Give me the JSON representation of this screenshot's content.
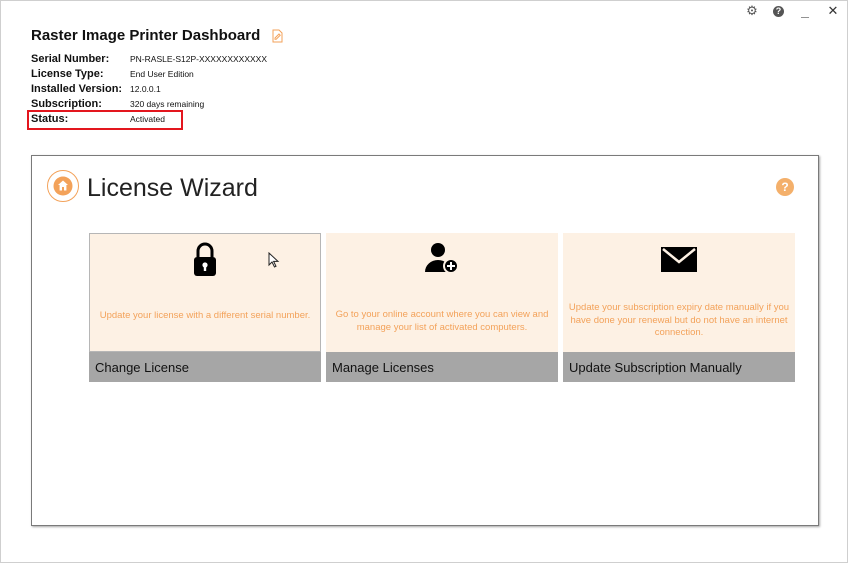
{
  "window": {
    "controls": {
      "settings_icon": "gear-icon",
      "help_icon": "help-icon",
      "help_glyph": "?",
      "minimize_glyph": "_",
      "close_glyph": "✕"
    }
  },
  "header": {
    "title": "Raster Image Printer Dashboard",
    "rows": [
      {
        "label": "Serial Number:",
        "value": "PN-RASLE-S12P-XXXXXXXXXXXX"
      },
      {
        "label": "License Type:",
        "value": "End User Edition"
      },
      {
        "label": "Installed Version:",
        "value": "12.0.0.1"
      },
      {
        "label": "Subscription:",
        "value": "320 days remaining"
      },
      {
        "label": "Status:",
        "value": "Activated"
      }
    ]
  },
  "wizard": {
    "title": "License Wizard",
    "help_glyph": "?",
    "tiles": [
      {
        "icon": "lock-icon",
        "description": "Update your license with a different serial number.",
        "label": "Change License"
      },
      {
        "icon": "add-user-icon",
        "description": "Go to your online account where you can view and manage your list of activated computers.",
        "label": "Manage Licenses"
      },
      {
        "icon": "envelope-icon",
        "description": "Update your subscription expiry date manually if you have done your renewal but do not have an internet connection.",
        "label": "Update Subscription Manually"
      }
    ]
  },
  "colors": {
    "accent": "#f3a25a",
    "tile_background": "#fdf1e4",
    "tile_footer": "#a6a6a6",
    "highlight": "#e3161e"
  }
}
